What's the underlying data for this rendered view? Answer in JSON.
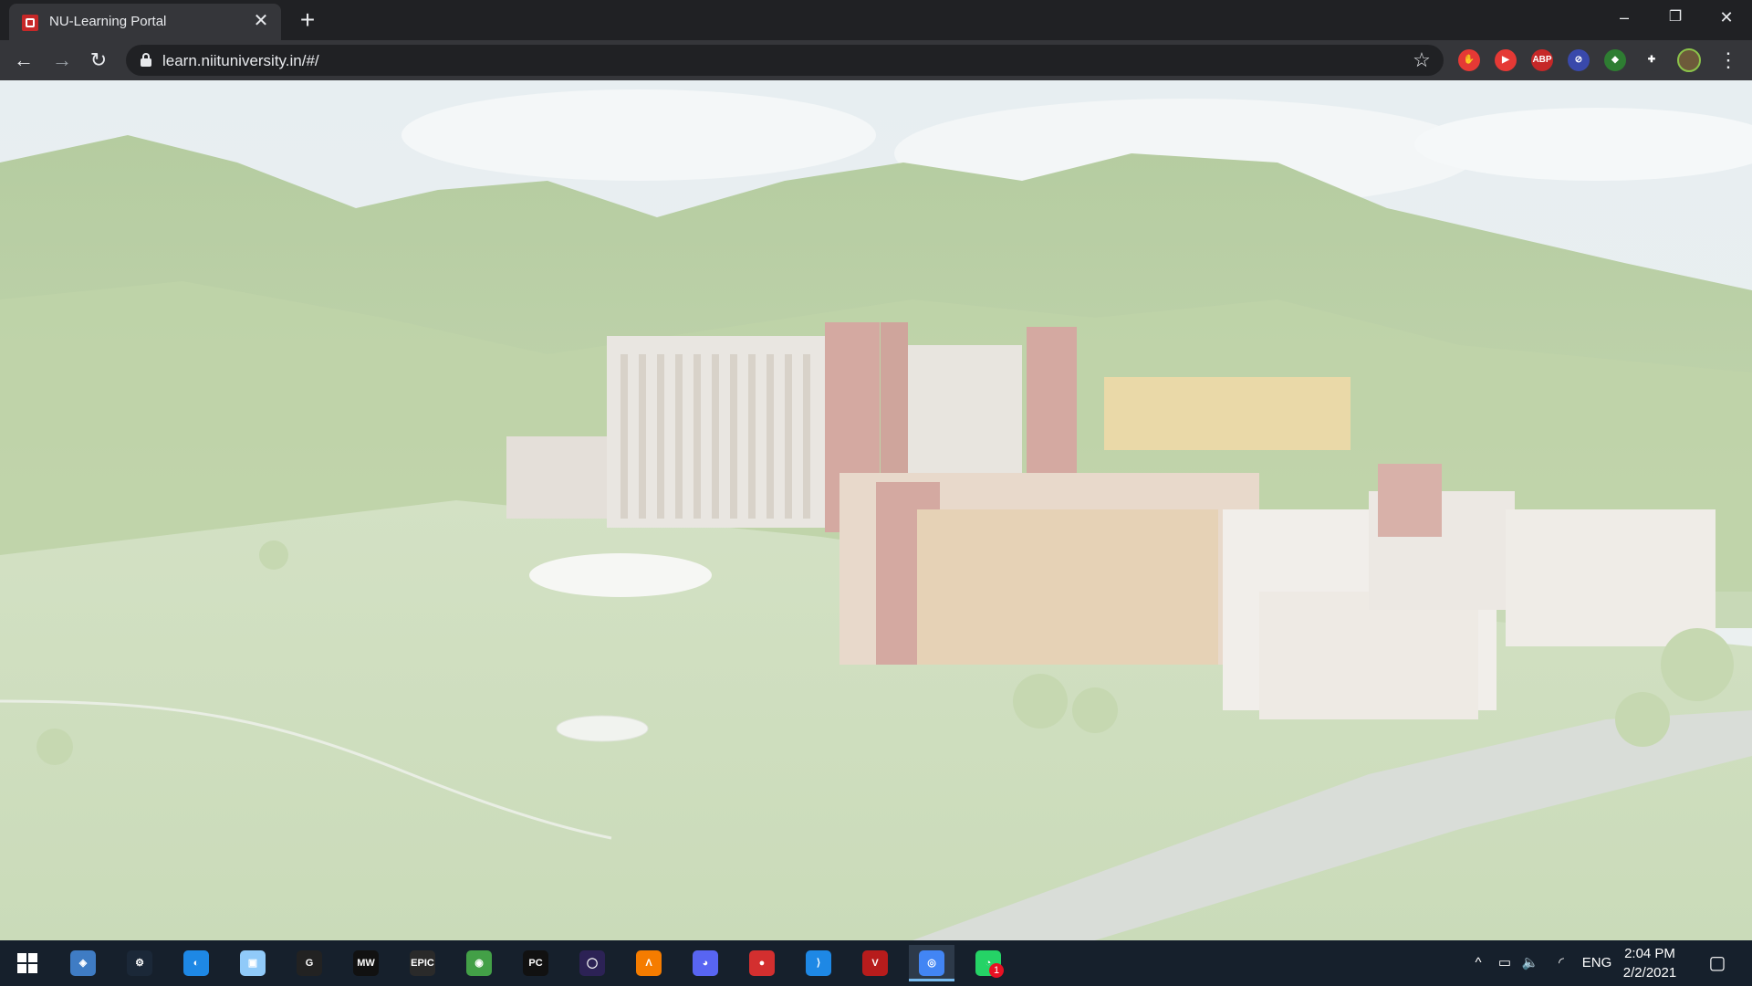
{
  "browser": {
    "tab": {
      "title": "NU-Learning Portal",
      "close_glyph": "✕"
    },
    "new_tab_glyph": "+",
    "window_controls": {
      "minimize": "–",
      "restore": "❐",
      "close": "✕"
    },
    "nav": {
      "back": "←",
      "forward": "→",
      "reload": "↻"
    },
    "address_bar": {
      "url": "learn.niituniversity.in/#/"
    },
    "bookmark_glyph": "☆",
    "extensions": [
      {
        "name": "hand-extension-icon",
        "label": "✋",
        "color": "#e53935"
      },
      {
        "name": "youtube-extension-icon",
        "label": "▶",
        "color": "#e53935"
      },
      {
        "name": "adblock-plus-icon",
        "label": "ABP",
        "color": "#c62828"
      },
      {
        "name": "blocker-extension-icon",
        "label": "⊘",
        "color": "#3949ab"
      },
      {
        "name": "colorful-extension-icon",
        "label": "◆",
        "color": "#2e7d32"
      },
      {
        "name": "extensions-puzzle-icon",
        "label": "✚",
        "color": "#35363a"
      }
    ],
    "menu_glyph": "⋮"
  },
  "page": {
    "background": "campus photo (hills, university buildings) faded"
  },
  "taskbar": {
    "apps": [
      {
        "name": "virtualbox-icon",
        "label": "◈",
        "color": "#3f7cc4"
      },
      {
        "name": "steam-icon",
        "label": "⚙",
        "color": "#1b2838"
      },
      {
        "name": "blue-app-icon",
        "label": "◐",
        "color": "#1e88e5"
      },
      {
        "name": "cube-app-icon",
        "label": "▣",
        "color": "#90caf9"
      },
      {
        "name": "logitech-g-icon",
        "label": "G",
        "color": "#222"
      },
      {
        "name": "mw-app-icon",
        "label": "MW",
        "color": "#111"
      },
      {
        "name": "epic-games-icon",
        "label": "EPIC",
        "color": "#2a2a2a"
      },
      {
        "name": "map-pin-app-icon",
        "label": "◉",
        "color": "#43a047"
      },
      {
        "name": "pycharm-icon",
        "label": "PC",
        "color": "#111"
      },
      {
        "name": "eclipse-icon",
        "label": "◯",
        "color": "#2c2255"
      },
      {
        "name": "orange-app-icon",
        "label": "Λ",
        "color": "#f57c00"
      },
      {
        "name": "discord-icon",
        "label": "◕",
        "color": "#5865f2"
      },
      {
        "name": "record-icon",
        "label": "●",
        "color": "#d32f2f"
      },
      {
        "name": "vscode-icon",
        "label": "⟩",
        "color": "#1e88e5"
      },
      {
        "name": "valorant-icon",
        "label": "V",
        "color": "#b71c1c"
      },
      {
        "name": "chrome-icon",
        "label": "◎",
        "color": "#4285f4"
      },
      {
        "name": "whatsapp-icon",
        "label": "◔",
        "color": "#25d366",
        "badge": "1"
      }
    ],
    "tray": {
      "chevron": "^",
      "battery": "▭",
      "volume": "🔈",
      "wifi": "◜",
      "lang": "ENG"
    },
    "clock": {
      "time": "2:04 PM",
      "date": "2/2/2021"
    },
    "notification_glyph": "▢"
  }
}
